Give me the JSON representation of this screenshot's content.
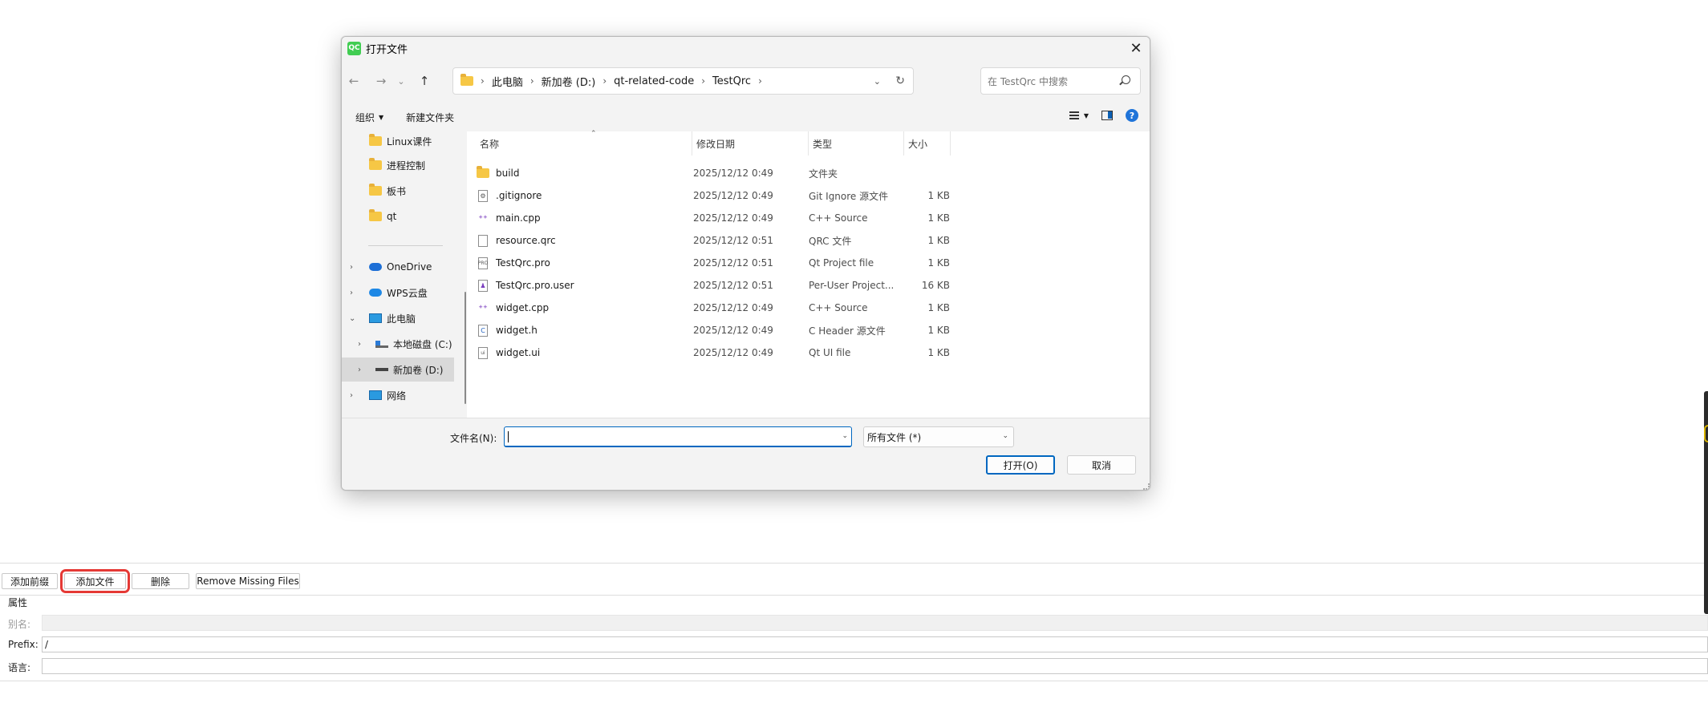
{
  "dialog": {
    "title": "打开文件",
    "app_icon_text": "QC",
    "close_glyph": "✕",
    "nav": {
      "back": "←",
      "forward": "→",
      "recent": "⌄",
      "up": "↑"
    },
    "breadcrumb": [
      "此电脑",
      "新加卷 (D:)",
      "qt-related-code",
      "TestQrc"
    ],
    "search_placeholder": "在 TestQrc 中搜索",
    "commands": {
      "organize": "组织",
      "new_folder": "新建文件夹"
    },
    "tree": [
      {
        "label": "Linux课件",
        "icon": "folder-icon"
      },
      {
        "label": "进程控制",
        "icon": "folder-icon"
      },
      {
        "label": "板书",
        "icon": "folder-icon"
      },
      {
        "label": "qt",
        "icon": "folder-icon"
      },
      {
        "label": "OneDrive",
        "icon": "cloud-icon"
      },
      {
        "label": "WPS云盘",
        "icon": "wps-cloud-icon"
      },
      {
        "label": "此电脑",
        "icon": "computer-icon"
      },
      {
        "label": "本地磁盘 (C:)",
        "icon": "disk-icon"
      },
      {
        "label": "新加卷 (D:)",
        "icon": "disk-icon"
      },
      {
        "label": "网络",
        "icon": "network-icon"
      }
    ],
    "columns": {
      "name": "名称",
      "date": "修改日期",
      "type": "类型",
      "size": "大小"
    },
    "files": [
      {
        "name": "build",
        "date": "2025/12/12 0:49",
        "type": "文件夹",
        "size": "",
        "icon": "folder-icon"
      },
      {
        "name": ".gitignore",
        "date": "2025/12/12 0:49",
        "type": "Git Ignore 源文件",
        "size": "1 KB",
        "icon": "gitignore-file-icon"
      },
      {
        "name": "main.cpp",
        "date": "2025/12/12 0:49",
        "type": "C++ Source",
        "size": "1 KB",
        "icon": "cpp-file-icon"
      },
      {
        "name": "resource.qrc",
        "date": "2025/12/12 0:51",
        "type": "QRC 文件",
        "size": "1 KB",
        "icon": "generic-file-icon"
      },
      {
        "name": "TestQrc.pro",
        "date": "2025/12/12 0:51",
        "type": "Qt Project file",
        "size": "1 KB",
        "icon": "pro-file-icon"
      },
      {
        "name": "TestQrc.pro.user",
        "date": "2025/12/12 0:51",
        "type": "Per-User Project...",
        "size": "16 KB",
        "icon": "user-file-icon"
      },
      {
        "name": "widget.cpp",
        "date": "2025/12/12 0:49",
        "type": "C++ Source",
        "size": "1 KB",
        "icon": "cpp-file-icon"
      },
      {
        "name": "widget.h",
        "date": "2025/12/12 0:49",
        "type": "C Header 源文件",
        "size": "1 KB",
        "icon": "header-file-icon"
      },
      {
        "name": "widget.ui",
        "date": "2025/12/12 0:49",
        "type": "Qt UI file",
        "size": "1 KB",
        "icon": "ui-file-icon"
      }
    ],
    "filename_label": "文件名(N):",
    "filename_value": "",
    "filter_value": "所有文件 (*)",
    "open_button": "打开(O)",
    "cancel_button": "取消"
  },
  "qt_panel": {
    "buttons": [
      "添加前缀",
      "添加文件",
      "删除",
      "Remove Missing Files"
    ],
    "props_title": "属性",
    "alias_label": "别名:",
    "prefix_label": "Prefix:",
    "prefix_value": "/",
    "language_label": "语言:"
  },
  "colors": {
    "accent": "#0067c0",
    "highlight_box": "#e53935",
    "folder": "#f6c745"
  }
}
